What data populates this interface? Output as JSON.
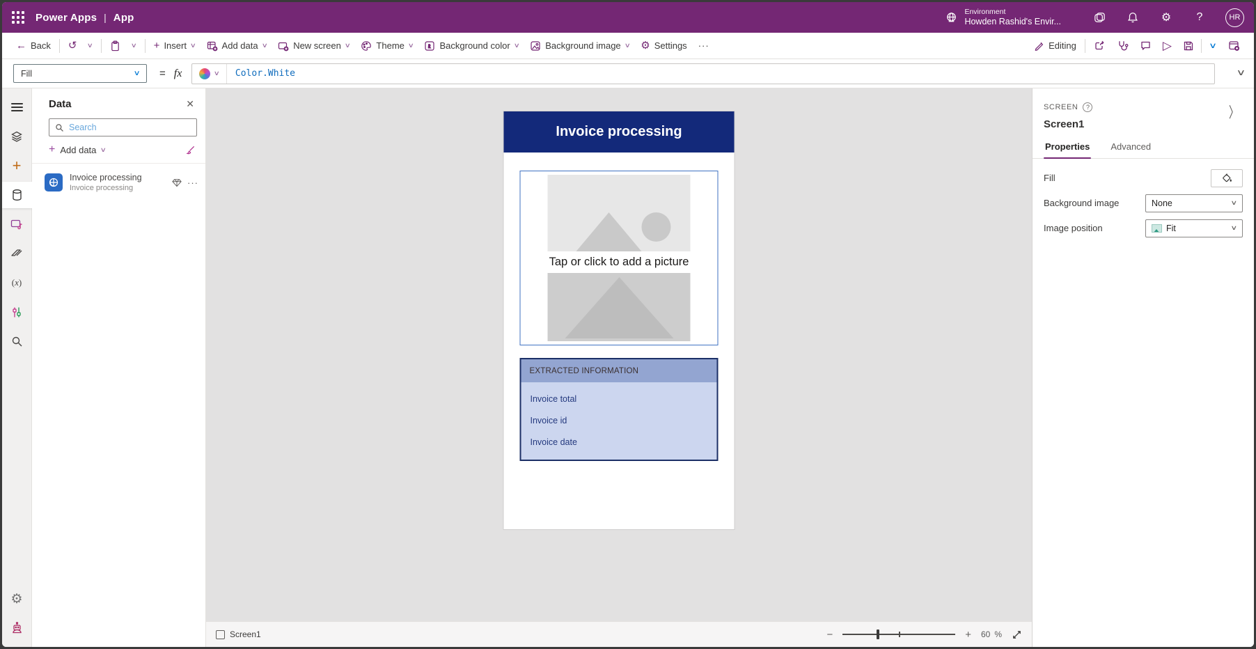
{
  "topbar": {
    "brand": "Power Apps",
    "separator": "|",
    "app": "App",
    "environment_label": "Environment",
    "environment_name": "Howden Rashid's Envir...",
    "help": "?",
    "avatar_initials": "HR"
  },
  "toolbar": {
    "back": "Back",
    "insert": "Insert",
    "add_data": "Add data",
    "new_screen": "New screen",
    "theme": "Theme",
    "background_color": "Background color",
    "background_image": "Background image",
    "settings": "Settings",
    "overflow": "···",
    "editing": "Editing"
  },
  "formula_bar": {
    "property": "Fill",
    "equals": "=",
    "fx": "fx",
    "expression": "Color.White"
  },
  "data_panel": {
    "title": "Data",
    "close": "✕",
    "search_placeholder": "Search",
    "add_data": "Add data",
    "items": [
      {
        "title": "Invoice processing",
        "subtitle": "Invoice processing",
        "more": "···"
      }
    ]
  },
  "canvas": {
    "app_title": "Invoice processing",
    "picture_prompt": "Tap or click to add a picture",
    "table": {
      "header": "EXTRACTED INFORMATION",
      "rows": [
        "Invoice total",
        "Invoice id",
        "Invoice date"
      ]
    }
  },
  "right_panel": {
    "section_label": "SCREEN",
    "help": "?",
    "screen_name": "Screen1",
    "tabs": [
      "Properties",
      "Advanced"
    ],
    "properties": [
      {
        "label": "Fill"
      },
      {
        "label": "Background image",
        "value": "None"
      },
      {
        "label": "Image position",
        "value": "Fit"
      }
    ]
  },
  "status_bar": {
    "screen_name": "Screen1",
    "zoom_value": "60",
    "zoom_unit": "%"
  },
  "colors": {
    "brand_purple": "#742774",
    "app_header_navy": "#13297a",
    "table_header_blue": "#93a5d1",
    "table_body_blue": "#ccd6ef",
    "accent_blue": "#0078d4"
  }
}
